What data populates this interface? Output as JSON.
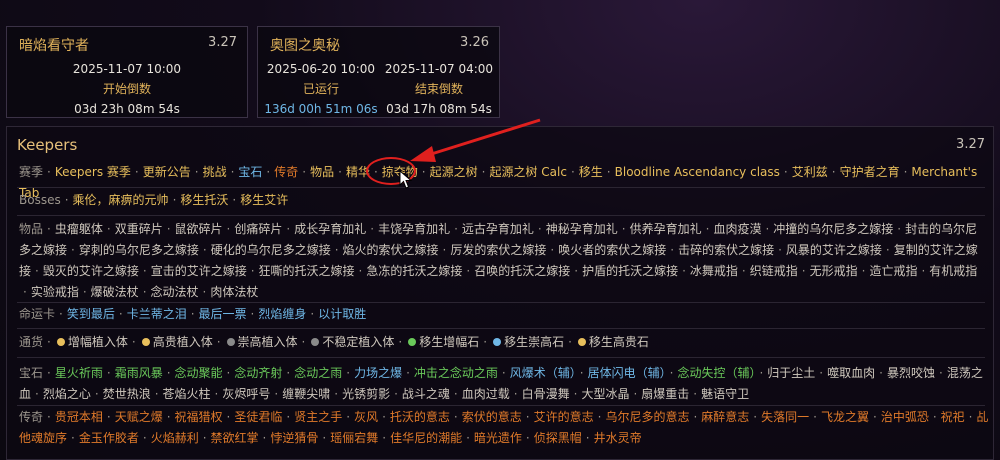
{
  "cards": [
    {
      "title": "暗焰看守者",
      "version": "3.27",
      "cols": [
        {
          "date": "2025-11-07 10:00",
          "label": "开始倒数",
          "value": "03d 23h 08m 54s"
        }
      ]
    },
    {
      "title": "奥图之奥秘",
      "version": "3.26",
      "cols": [
        {
          "date": "2025-06-20 10:00",
          "label": "已运行",
          "value": "136d 00h 51m 06s"
        },
        {
          "date": "2025-11-07 04:00",
          "label": "结束倒数",
          "value": "03d 17h 08m 54s"
        }
      ]
    }
  ],
  "keepers": {
    "title": "Keepers",
    "version": "3.27"
  },
  "nav": {
    "label": "赛季",
    "items": [
      "Keepers 赛季",
      "更新公告",
      "挑战",
      "宝石",
      "传奇",
      "物品",
      "精华",
      "掠夺物",
      "起源之树",
      "起源之树 Calc",
      "移生",
      "Bloodline Ascendancy class",
      "艾利兹",
      "守护者之育",
      "Merchant's Tab"
    ]
  },
  "bosses": {
    "label": "Bosses",
    "items": [
      "乘伦，麻痹的元帅",
      "移生托沃",
      "移生艾许"
    ]
  },
  "items_row": {
    "label": "物品",
    "items": [
      "虫瘤躯体",
      "双重碎片",
      "鼠欲碎片",
      "创痛碎片",
      "成长孕育加礼",
      "丰饶孕育加礼",
      "远古孕育加礼",
      "神秘孕育加礼",
      "供养孕育加礼",
      "血肉疫漠",
      "冲撞的乌尔尼多之嫁接",
      "封击的乌尔尼多之嫁接",
      "穿刺的乌尔尼多之嫁接",
      "硬化的乌尔尼多之嫁接",
      "焰火的索伏之嫁接",
      "厉发的索伏之嫁接",
      "唤火者的索伏之嫁接",
      "击碎的索伏之嫁接",
      "风暴的艾许之嫁接",
      "复制的艾许之嫁接",
      "毁灭的艾许之嫁接",
      "宣击的艾许之嫁接",
      "狂嘶的托沃之嫁接",
      "急冻的托沃之嫁接",
      "召唤的托沃之嫁接",
      "护盾的托沃之嫁接",
      "冰舞戒指",
      "织链戒指",
      "无形戒指",
      "造亡戒指",
      "有机戒指",
      "实验戒指",
      "爆破法杖",
      "念动法杖",
      "肉体法杖"
    ]
  },
  "fate": {
    "label": "命运卡",
    "items": [
      "笑到最后",
      "卡兰蒂之泪",
      "最后一票",
      "烈焰缠身",
      "以计取胜"
    ]
  },
  "currency": {
    "label": "通货",
    "items": [
      "增幅植入体",
      "高贵植入体",
      "崇高植入体",
      "不稳定植入体",
      "移生增幅石",
      "移生崇高石",
      "移生高贵石"
    ]
  },
  "gems": {
    "label": "宝石",
    "items": [
      "星火祈雨",
      "霜雨风暴",
      "念动聚能",
      "念动齐射",
      "念动之雨",
      "力场之爆",
      "冲击之念动之雨",
      "风爆术（辅）",
      "居体闪电（辅）",
      "念动失控（辅）",
      "归于尘土",
      "噬取血肉",
      "暴烈咬蚀",
      "混荡之血",
      "烈焰之心",
      "焚世热浪",
      "苍焰火柱",
      "灰烬呼号",
      "缠鞭尖啸",
      "光锈剪影",
      "战斗之魂",
      "血肉过载",
      "白骨漫舞",
      "大型冰晶",
      "扇爆重击",
      "魅语守卫"
    ]
  },
  "uniques": {
    "label": "传奇",
    "items": [
      "贵冠本相",
      "天赋之爆",
      "祝福猎权",
      "圣徒君临",
      "贤主之手",
      "灰风",
      "托沃的意志",
      "索伏的意志",
      "艾许的意志",
      "乌尔尼多的意志",
      "麻醉意志",
      "失落同一",
      "飞龙之翼",
      "治中弧恐",
      "祝祀",
      "乩他魂旋序",
      "金玉作胶者",
      "火焰赫利",
      "禁欲红掌",
      "悖逆猜骨",
      "瑶俪宕舞",
      "佳华尼的潮能",
      "暗光遗作",
      "侦探黑帽",
      "井水灵帝"
    ]
  }
}
